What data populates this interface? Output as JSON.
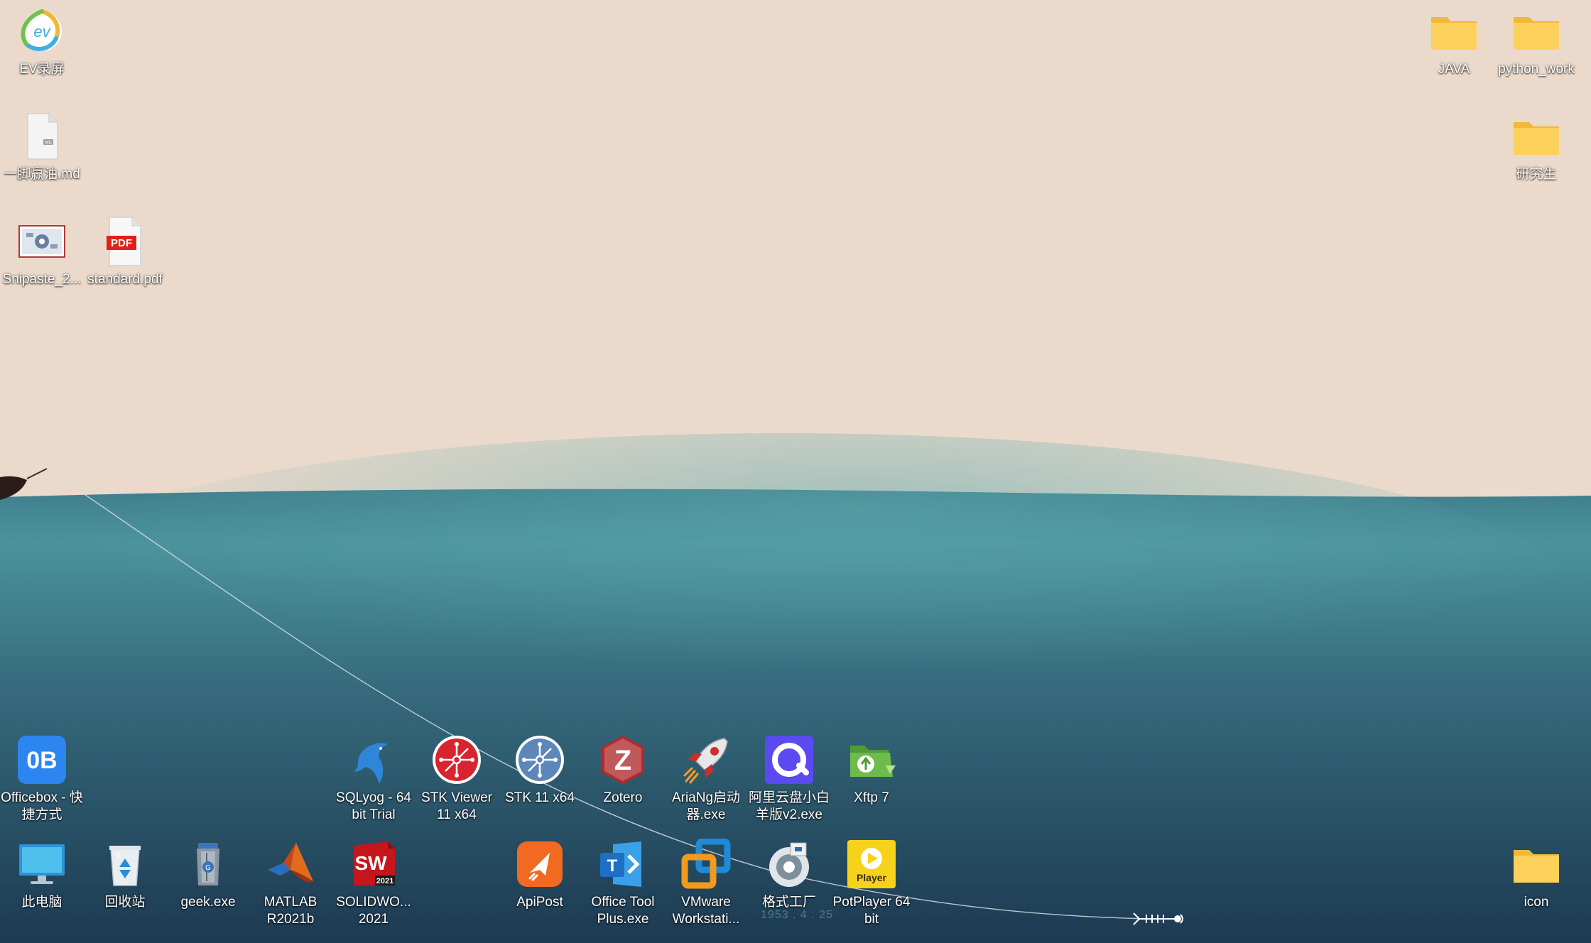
{
  "desktop": {
    "top_left": [
      {
        "name": "ev-recorder-icon",
        "label": "EV录屏",
        "icon": "ev-recorder-icon"
      },
      {
        "name": "markdown-file-icon",
        "label": "一脚赢油.md",
        "icon": "markdown-file-icon"
      },
      {
        "name": "snipaste-image-icon",
        "label": "Snipaste_2...",
        "icon": "image-thumbnail-icon"
      },
      {
        "name": "pdf-file-icon",
        "label": "standard.pdf",
        "icon": "pdf-icon"
      }
    ],
    "top_right": [
      {
        "name": "folder-java",
        "label": "JAVA",
        "icon": "folder-icon"
      },
      {
        "name": "folder-python-work",
        "label": "python_work",
        "icon": "folder-icon"
      },
      {
        "name": "folder-graduate",
        "label": "研究生",
        "icon": "folder-icon"
      }
    ],
    "row1": [
      {
        "label": "Officebox - 快捷方式",
        "icon": "officebox-icon"
      },
      {
        "label": "SQLyog - 64 bit Trial",
        "icon": "dolphin-icon"
      },
      {
        "label": "STK Viewer 11 x64",
        "icon": "stk-viewer-icon"
      },
      {
        "label": "STK 11 x64",
        "icon": "stk-icon"
      },
      {
        "label": "Zotero",
        "icon": "zotero-icon"
      },
      {
        "label": "AriaNg启动器.exe",
        "icon": "rocket-icon"
      },
      {
        "label": "阿里云盘小白羊版v2.exe",
        "icon": "aliyun-drive-icon"
      },
      {
        "label": "Xftp 7",
        "icon": "xftp-icon"
      }
    ],
    "row2": [
      {
        "label": "此电脑",
        "icon": "monitor-icon"
      },
      {
        "label": "回收站",
        "icon": "recycle-bin-icon"
      },
      {
        "label": "geek.exe",
        "icon": "geek-trash-icon"
      },
      {
        "label": "MATLAB R2021b",
        "icon": "matlab-icon"
      },
      {
        "label": "SOLIDWO... 2021",
        "icon": "solidworks-icon"
      },
      {
        "label": "ApiPost",
        "icon": "apipost-icon"
      },
      {
        "label": "Office Tool Plus.exe",
        "icon": "office-tool-icon"
      },
      {
        "label": "VMware Workstati...",
        "icon": "vmware-icon"
      },
      {
        "label": "格式工厂",
        "icon": "format-factory-icon"
      },
      {
        "label": "PotPlayer 64 bit",
        "icon": "potplayer-icon"
      }
    ],
    "bottom_right": {
      "label": "icon",
      "icon": "folder-icon"
    },
    "wallpaper_caption": "1953 . 4 . 25"
  }
}
